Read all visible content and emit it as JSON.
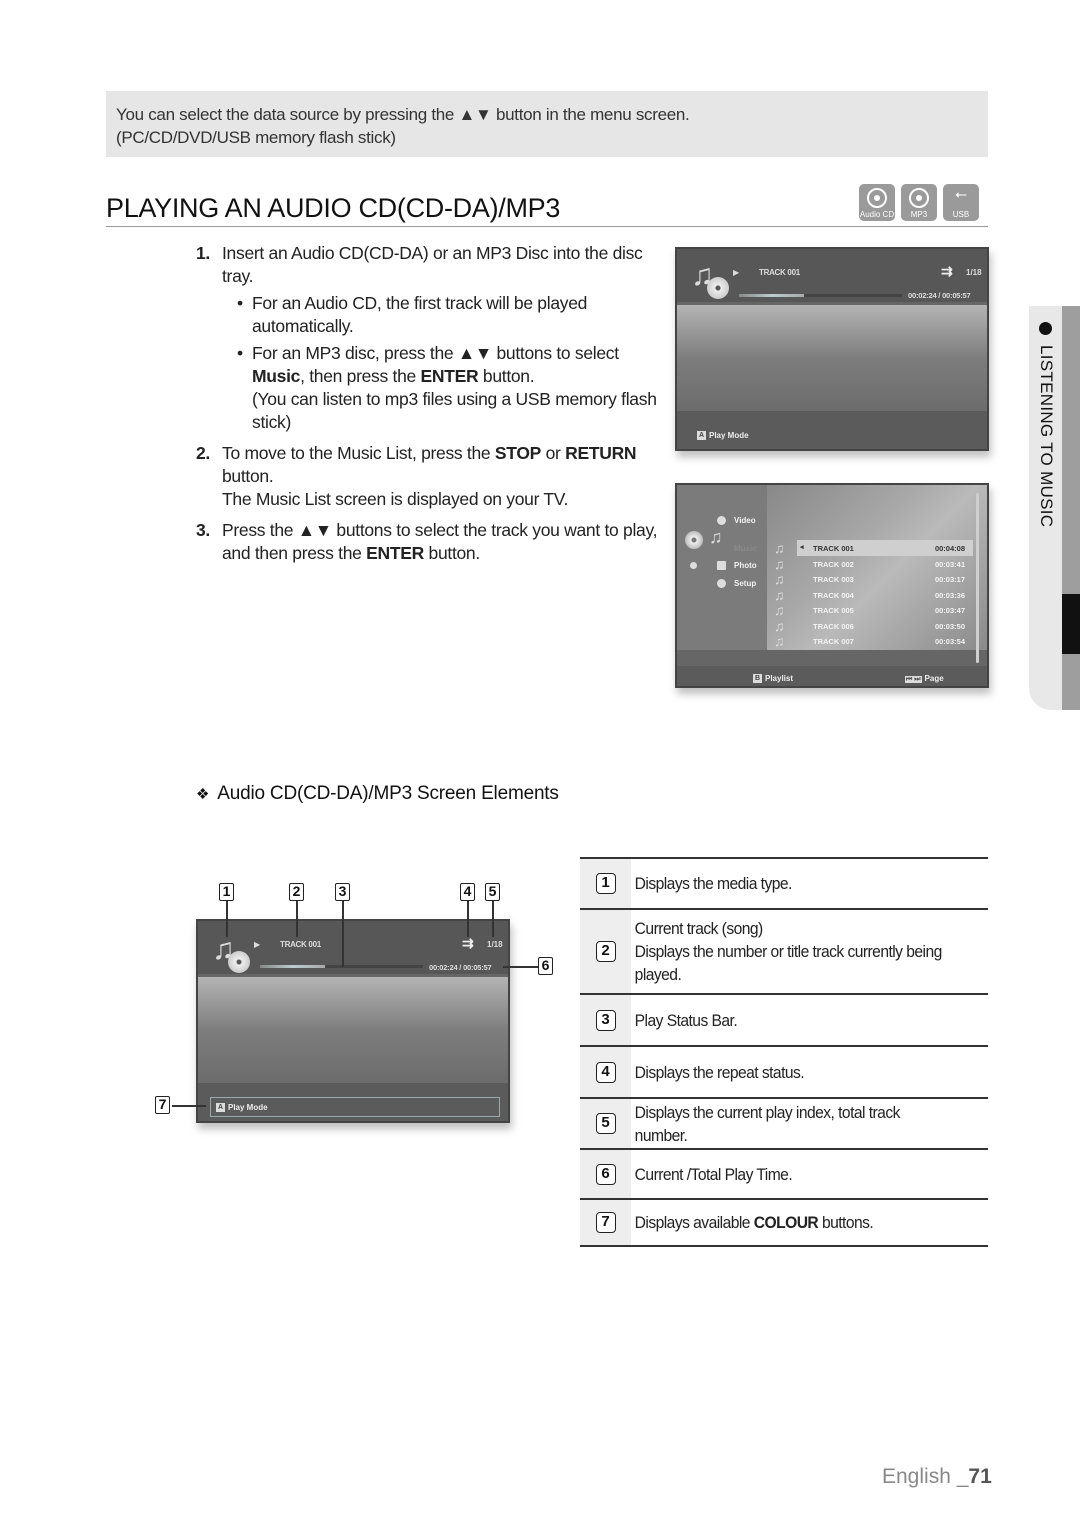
{
  "note": {
    "line1": "You can select the data source by pressing the ▲▼ button in the menu screen.",
    "line2": "(PC/CD/DVD/USB memory flash stick)"
  },
  "section": {
    "title": "PLAYING AN AUDIO CD(CD-DA)/MP3",
    "media_icons": [
      {
        "name": "audio-cd-icon",
        "label": "Audio CD"
      },
      {
        "name": "mp3-icon",
        "label": "MP3"
      },
      {
        "name": "usb-icon",
        "label": "USB",
        "glyph": "⭠"
      }
    ]
  },
  "steps": [
    {
      "num": "1.",
      "text": "Insert an Audio CD(CD-DA) or an MP3 Disc into the disc tray.",
      "bullets": [
        {
          "text": "For an Audio CD, the first track will be played automatically."
        },
        {
          "pre": "For an MP3 disc, press the ▲▼ buttons to select ",
          "bold1": "Music",
          "mid": ", then press the ",
          "bold2": "ENTER",
          "post": " button.",
          "extra": "(You can listen to mp3 files using a USB memory flash stick)"
        }
      ]
    },
    {
      "num": "2.",
      "pre": "To move to the Music List, press the ",
      "bold1": "STOP",
      "mid": " or ",
      "bold2": "RETURN",
      "post": " button.",
      "extra": "The Music List screen is displayed on your TV."
    },
    {
      "num": "3.",
      "pre": "Press the ▲▼ buttons to select the track you want to play, and then press the ",
      "bold1": "ENTER",
      "post": " button."
    }
  ],
  "player_screen": {
    "play_glyph": "▶",
    "track": "TRACK 001",
    "repeat_glyph": "⇉",
    "index": "1/18",
    "time": "00:02:24 / 00:05:57",
    "progress_fraction": 0.4,
    "cd_label": "CD",
    "footer_key": "A",
    "footer_label": "Play Mode"
  },
  "music_list_screen": {
    "menu": [
      {
        "label": "Video",
        "active": false
      },
      {
        "label": "Music",
        "active": true
      },
      {
        "label": "Photo",
        "active": false
      },
      {
        "label": "Setup",
        "active": false
      }
    ],
    "tracks": [
      {
        "name": "TRACK 001",
        "duration": "00:04:08",
        "selected": true
      },
      {
        "name": "TRACK 002",
        "duration": "00:03:41",
        "selected": false
      },
      {
        "name": "TRACK 003",
        "duration": "00:03:17",
        "selected": false
      },
      {
        "name": "TRACK 004",
        "duration": "00:03:36",
        "selected": false
      },
      {
        "name": "TRACK 005",
        "duration": "00:03:47",
        "selected": false
      },
      {
        "name": "TRACK 006",
        "duration": "00:03:50",
        "selected": false
      },
      {
        "name": "TRACK 007",
        "duration": "00:03:54",
        "selected": false
      }
    ],
    "footer_key": "B",
    "footer_label": "Playlist",
    "page_keys": "⏮ ⏭",
    "page_label": "Page"
  },
  "side_tab": {
    "label": "LISTENING TO MUSIC"
  },
  "subheading": {
    "glyph": "❖",
    "text": "Audio CD(CD-DA)/MP3 Screen Elements"
  },
  "diagram_callouts": [
    "1",
    "2",
    "3",
    "4",
    "5",
    "6",
    "7"
  ],
  "elements": [
    {
      "num": "1",
      "lines": [
        "Displays the media type."
      ]
    },
    {
      "num": "2",
      "lines": [
        "Current track (song)",
        "Displays the number or title track currently being played."
      ]
    },
    {
      "num": "3",
      "lines": [
        "Play Status Bar."
      ]
    },
    {
      "num": "4",
      "lines": [
        "Displays the repeat status."
      ]
    },
    {
      "num": "5",
      "lines": [
        "Displays the current play index, total track number."
      ]
    },
    {
      "num": "6",
      "lines": [
        "Current /Total Play Time."
      ]
    },
    {
      "num": "7",
      "pre": "Displays available ",
      "bold": "COLOUR",
      "post": " buttons."
    }
  ],
  "footer": {
    "language": "English _",
    "page": "71"
  }
}
